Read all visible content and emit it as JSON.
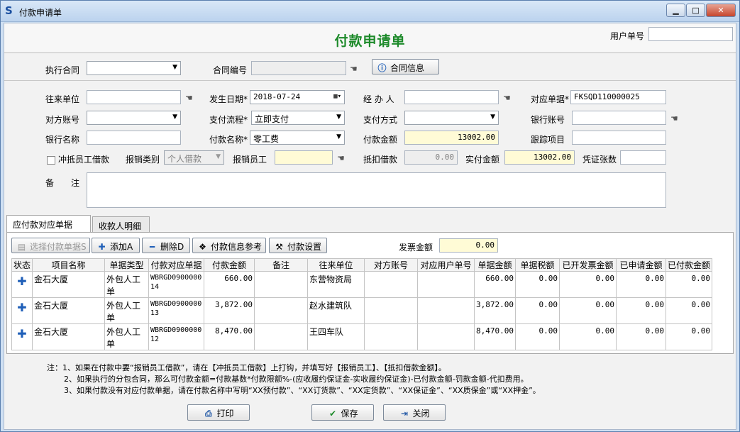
{
  "window": {
    "title": "付款申请单"
  },
  "header": {
    "title": "付款申请单",
    "user_no_label": "用户单号",
    "user_no_value": ""
  },
  "contract": {
    "exec_label": "执行合同",
    "exec_value": "",
    "no_label": "合同编号",
    "no_value": "",
    "info_button": "合同信息"
  },
  "form": {
    "payee_label": "往来单位",
    "payee_value": "",
    "date_label": "发生日期*",
    "date_value": "2018-07-24",
    "handler_label": "经 办 人",
    "handler_value": "",
    "doc_label": "对应单据*",
    "doc_value": "FKSQD110000025",
    "account_label": "对方账号",
    "account_value": "",
    "flow_label": "支付流程*",
    "flow_value": "立即支付",
    "method_label": "支付方式",
    "method_value": "",
    "bank_acct_label": "银行账号",
    "bank_acct_value": "",
    "bank_label": "银行名称",
    "bank_value": "",
    "payname_label": "付款名称*",
    "payname_value": "零工费",
    "amount_label": "付款金额",
    "amount_value": "13002.00",
    "track_label": "跟踪项目",
    "track_value": "",
    "offset_label": "冲抵员工借款",
    "reimb_type_label": "报销类别",
    "reimb_type_value": "个人借款",
    "reimb_emp_label": "报销员工",
    "reimb_emp_value": "",
    "deduct_label": "抵扣借款",
    "deduct_value": "0.00",
    "actual_label": "实付金额",
    "actual_value": "13002.00",
    "voucher_label": "凭证张数",
    "voucher_value": "",
    "remark_label": "备　注",
    "remark_value": ""
  },
  "tabs": [
    "应付款对应单据",
    "收款人明细"
  ],
  "toolbar": {
    "select": "选择付款单据S",
    "add": "添加A",
    "delete": "删除D",
    "ref": "付款信息参考",
    "settings": "付款设置",
    "invoice_label": "发票金额",
    "invoice_value": "0.00"
  },
  "grid": {
    "headers": [
      "状态",
      "项目名称",
      "单据类型",
      "付款对应单据",
      "付款金额",
      "备注",
      "往来单位",
      "对方账号",
      "对应用户单号",
      "单据金额",
      "单据税额",
      "已开发票金额",
      "已申请金额",
      "已付款金额"
    ],
    "rows": [
      {
        "project": "金石大厦",
        "type": "外包人工单",
        "doc1": "WBRGD0900000",
        "doc2": "14",
        "pay": "660.00",
        "remark": "",
        "unit": "东营物资局",
        "acct": "",
        "userno": "",
        "amt": "660.00",
        "tax": "0.00",
        "inv": "0.00",
        "applied": "0.00",
        "paid": "0.00"
      },
      {
        "project": "金石大厦",
        "type": "外包人工单",
        "doc1": "WBRGD0900000",
        "doc2": "13",
        "pay": "3,872.00",
        "remark": "",
        "unit": "赵水建筑队",
        "acct": "",
        "userno": "",
        "amt": "3,872.00",
        "tax": "0.00",
        "inv": "0.00",
        "applied": "0.00",
        "paid": "0.00"
      },
      {
        "project": "金石大厦",
        "type": "外包人工单",
        "doc1": "WBRGD0900000",
        "doc2": "12",
        "pay": "8,470.00",
        "remark": "",
        "unit": "王四车队",
        "acct": "",
        "userno": "",
        "amt": "8,470.00",
        "tax": "0.00",
        "inv": "0.00",
        "applied": "0.00",
        "paid": "0.00"
      }
    ]
  },
  "notes": [
    "注：1、如果在付款中要“报销员工借款”，请在【冲抵员工借款】上打钩，并填写好【报销员工】、【抵扣借款金额】。",
    "2、如果执行的分包合同，那么可付款金额=付款基数*付款限额%-(应收履约保证金-实收履约保证金)-已付款金额-罚款金额-代扣费用。",
    "3、如果付款没有对应付款单据，请在付款名称中写明“XX预付款”、“XX订货款”、“XX定货款”、“XX保证金”、“XX质保金”或“XX押金”。"
  ],
  "buttons": {
    "print": "打印",
    "save": "保存",
    "close": "关闭"
  }
}
